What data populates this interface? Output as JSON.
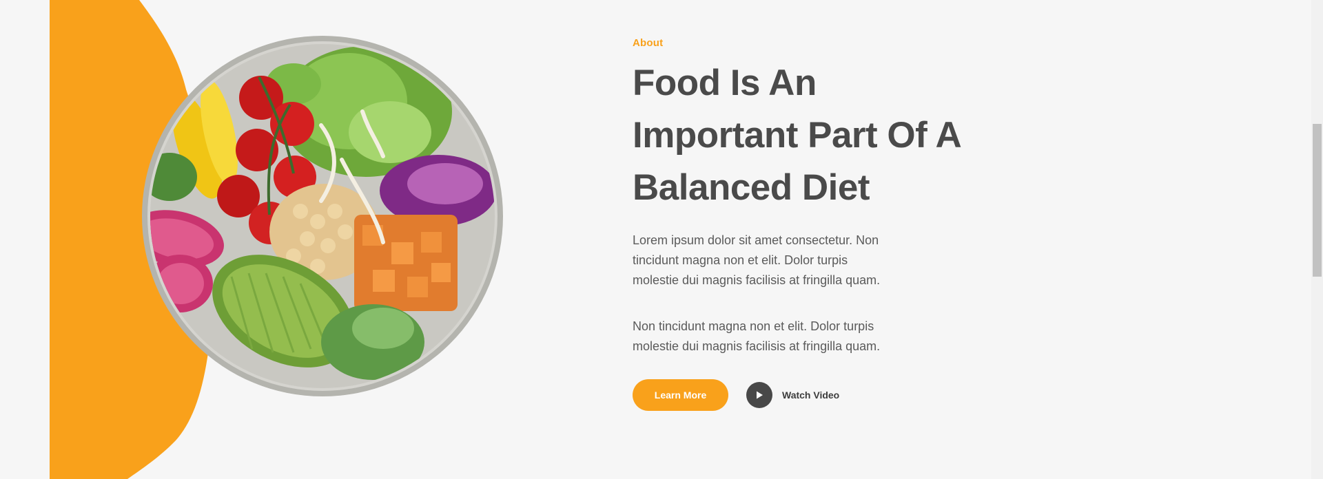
{
  "about": {
    "eyebrow": "About",
    "headline_lines": [
      "Food Is An",
      "Important Part Of A",
      "Balanced Diet"
    ],
    "paragraph1_lines": [
      "Lorem ipsum dolor sit amet consectetur. Non",
      "tincidunt magna non et elit. Dolor turpis",
      "molestie dui magnis facilisis at fringilla quam."
    ],
    "paragraph2_lines": [
      "Non tincidunt magna non et elit. Dolor turpis",
      "molestie dui magnis facilisis at fringilla quam."
    ]
  },
  "actions": {
    "learn_more_label": "Learn More",
    "watch_video_label": "Watch Video"
  },
  "icons": {
    "play": "play-icon"
  },
  "colors": {
    "accent": "#f9a11b",
    "heading": "#4a4a4a",
    "body_text": "#5a5a5a",
    "background": "#f6f6f6",
    "play_button": "#484848"
  },
  "scroll": {
    "position_fraction": 0.26
  }
}
